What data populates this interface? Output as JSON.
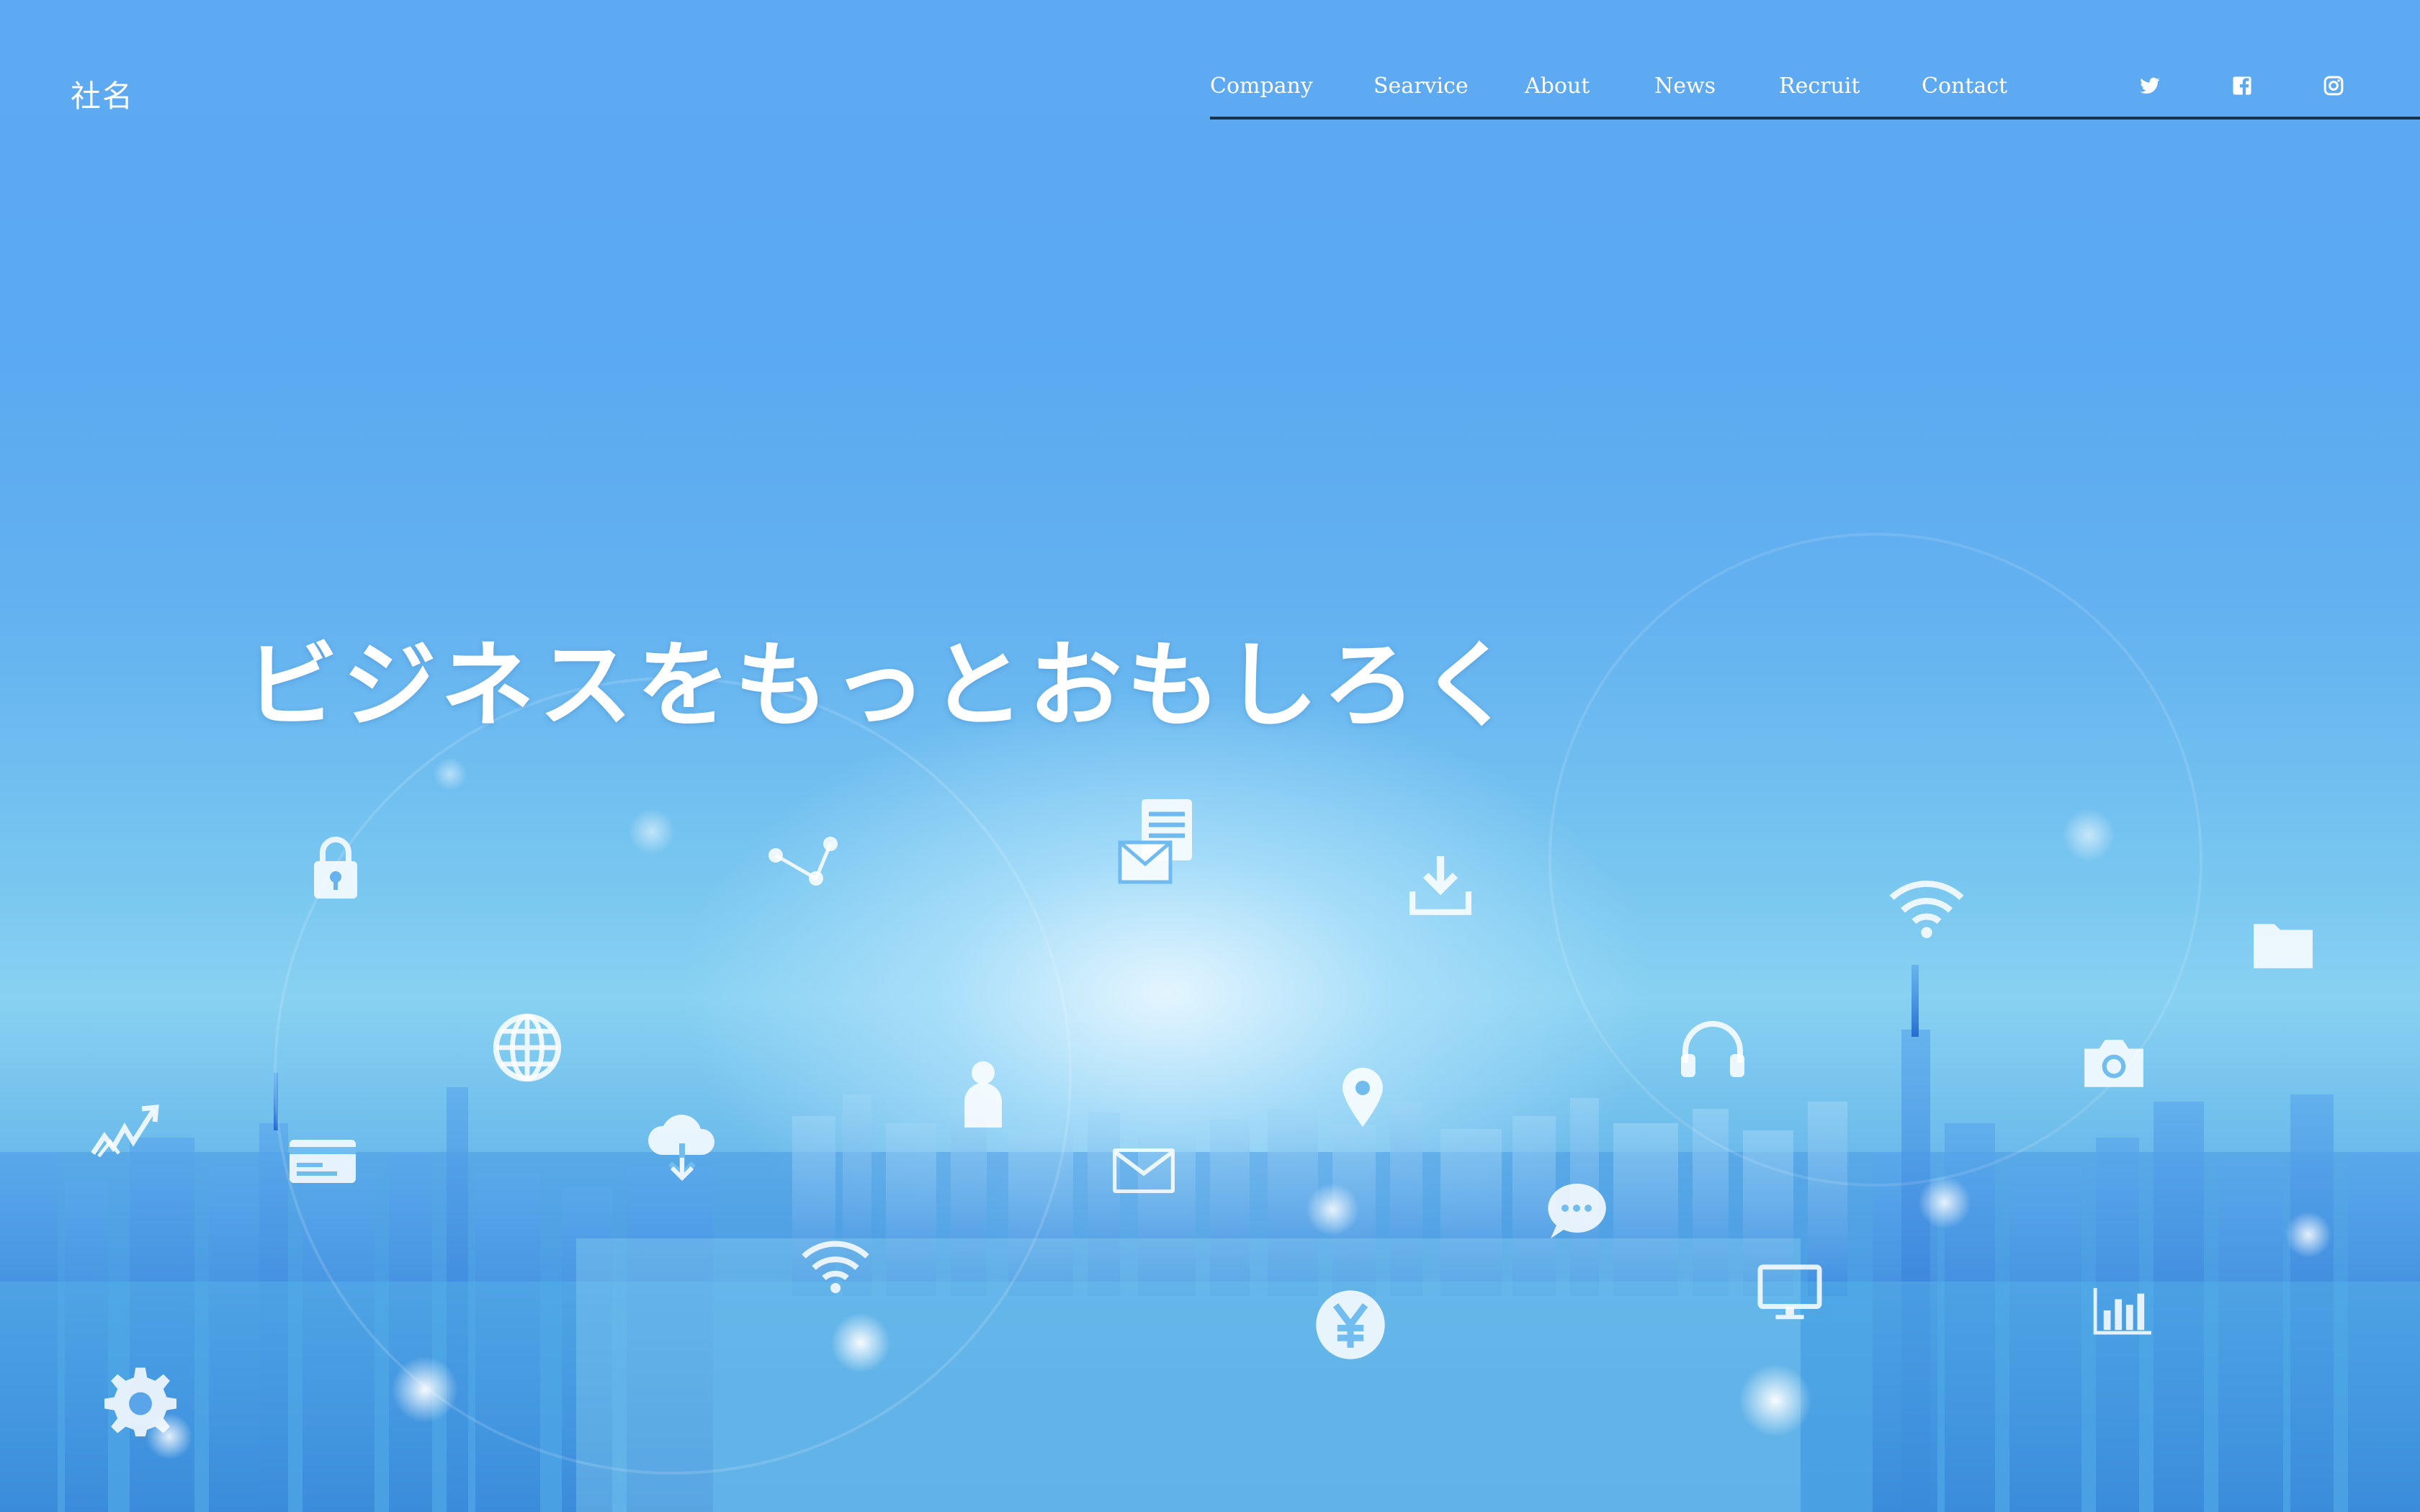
{
  "header": {
    "logo": "社名",
    "nav": [
      {
        "label": "Company"
      },
      {
        "label": "Searvice"
      },
      {
        "label": "About"
      },
      {
        "label": "News"
      },
      {
        "label": "Recruit"
      },
      {
        "label": "Contact"
      }
    ],
    "social": [
      "twitter-icon",
      "facebook-icon",
      "instagram-icon"
    ]
  },
  "hero": {
    "headline": "ビジネスをもっとおもしろく",
    "background_icons": [
      "lock-icon",
      "share-icon",
      "document-mail-icon",
      "download-icon",
      "wifi-icon",
      "folder-icon",
      "globe-icon",
      "user-icon",
      "location-pin-icon",
      "headphones-icon",
      "camera-icon",
      "trend-chart-icon",
      "id-card-icon",
      "cloud-download-icon",
      "mail-icon",
      "chat-icon",
      "monitor-icon",
      "bar-chart-icon",
      "yen-icon",
      "gear-icon"
    ]
  },
  "colors": {
    "sky_top": "#5ea9f3",
    "sky_glow": "#e8f7ff",
    "city_deep": "#2f7fd8",
    "nav_underline": "#17324f",
    "text": "#ffffff"
  }
}
